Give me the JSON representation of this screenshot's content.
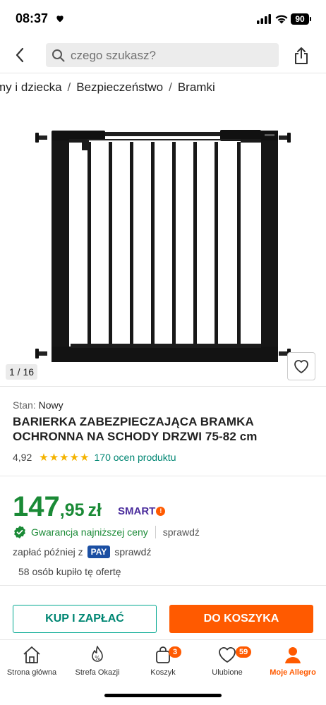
{
  "status_bar": {
    "time": "08:37",
    "battery": "90"
  },
  "search": {
    "placeholder": "czego szukasz?"
  },
  "breadcrumb": [
    "my i dziecka",
    "Bezpieczeństwo",
    "Bramki"
  ],
  "gallery": {
    "counter": "1 / 16"
  },
  "product": {
    "condition_label": "Stan:",
    "condition_value": "Nowy",
    "title": "BARIERKA ZABEZPIECZAJĄCA BRAMKA OCHRONNA NA SCHODY DRZWI 75-82 cm",
    "rating_value": "4,92",
    "stars": "★★★★★",
    "rating_count": "170 ocen produktu"
  },
  "price": {
    "integer": "147",
    "decimal": ",95",
    "currency": "zł",
    "smart_label": "SMART"
  },
  "guarantee": {
    "text": "Gwarancja najniższej ceny",
    "check_label": "sprawdź"
  },
  "pay_later": {
    "prefix": "zapłać później z",
    "badge": "PAY",
    "check_label": "sprawdź"
  },
  "bought": "58 osób kupiło tę ofertę",
  "actions": {
    "buy_now": "KUP I ZAPŁAĆ",
    "add_to_cart": "DO KOSZYKA"
  },
  "nav": [
    {
      "label": "Strona główna",
      "icon": "home-icon"
    },
    {
      "label": "Strefa Okazji",
      "icon": "deals-icon"
    },
    {
      "label": "Koszyk",
      "icon": "cart-icon",
      "badge": "3"
    },
    {
      "label": "Ulubione",
      "icon": "heart-icon",
      "badge": "59"
    },
    {
      "label": "Moje Allegro",
      "icon": "user-icon",
      "active": true
    }
  ],
  "colors": {
    "accent": "#ff5a00",
    "price": "#1a8a36",
    "teal": "#008673",
    "pay": "#1b4fa3",
    "smart": "#4a2c9c"
  }
}
